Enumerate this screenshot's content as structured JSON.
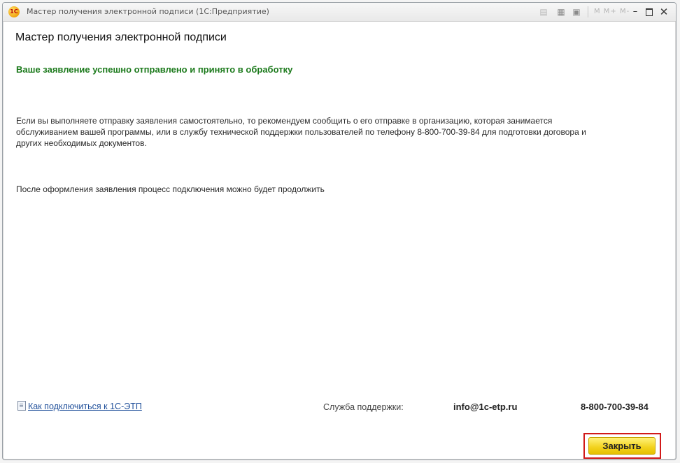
{
  "window": {
    "title": "Мастер получения электронной подписи  (1С:Предприятие)",
    "logo_text": "1С",
    "m_buttons": "M M+ M-"
  },
  "main": {
    "title": "Мастер получения электронной подписи",
    "success_message": "Ваше заявление успешно отправлено и принято в обработку",
    "para1_lines": [
      "Если вы выполняете отправку заявления самостоятельно, то рекомендуем сообщить о его отправке в организацию, которая занимается",
      "обслуживанием вашей программы, или в службу технической поддержки пользователей по телефону 8-800-700-39-84 для подготовки договора и",
      "других необходимых документов."
    ],
    "para2": "После оформления заявления процесс подключения можно будет продолжить"
  },
  "footer": {
    "link_text": "Как подключиться к 1С-ЭТП",
    "support_label": "Служба поддержки:",
    "support_email": "info@1c-etp.ru",
    "support_phone": "8-800-700-39-84"
  },
  "buttons": {
    "close_label": "Закрыть"
  },
  "colors": {
    "success": "#1c7a1c",
    "close_button": "#f2d21c",
    "highlight": "#d11a1a"
  }
}
